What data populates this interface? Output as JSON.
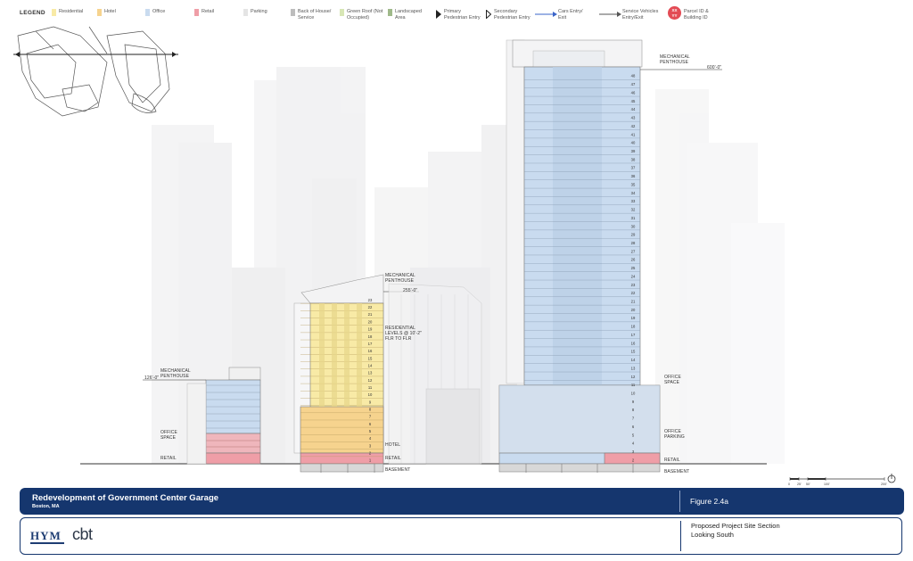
{
  "legend": {
    "title": "LEGEND",
    "items": [
      {
        "label": "Residential",
        "color": "#f8eaa6"
      },
      {
        "label": "Hotel",
        "color": "#f6d38e"
      },
      {
        "label": "Office",
        "color": "#c9dbef"
      },
      {
        "label": "Retail",
        "color": "#ef9ea7"
      },
      {
        "label": "Parking",
        "color": "#e4e4e4"
      },
      {
        "label": "Back of House/ Service",
        "color": "#bdbdbd"
      },
      {
        "label": "Green Roof (Not Occupied)",
        "color": "#d7e6b5"
      },
      {
        "label": "Landscaped Area",
        "color": "#9fb98a"
      }
    ],
    "arrows": [
      {
        "label": "Primary Pedestrian Entry",
        "icon": "filled-triangle-icon"
      },
      {
        "label": "Secondary Pedestrian Entry",
        "icon": "outline-triangle-icon"
      },
      {
        "label": "Cars Entry/ Exit",
        "icon": "blue-arrow-icon",
        "color": "#3a64c8"
      },
      {
        "label": "Service Vehicles Entry/Exit",
        "icon": "gray-arrow-icon",
        "color": "#555555"
      }
    ],
    "parcel": {
      "badge_top": "XX",
      "badge_bottom": "YY",
      "label": "Parcel ID & Building ID"
    }
  },
  "annotations": {
    "left_penthouse": "MECHANICAL PENTHOUSE",
    "left_height": "126'-0\"",
    "left_office": "OFFICE SPACE",
    "left_retail": "RETAIL",
    "mid_penthouse": "MECHANICAL PENTHOUSE",
    "mid_height": "255'-0\"",
    "mid_residential": "RESIDENTIAL LEVELS @ 10'-2\" FLR TO FLR",
    "mid_hotel": "HOTEL",
    "mid_retail": "RETAIL",
    "mid_basement": "BASEMENT",
    "tower_penthouse": "MECHANICAL PENTHOUSE",
    "tower_height": "600'-0\"",
    "tower_office_space": "OFFICE SPACE",
    "tower_office_parking": "OFFICE PARKING",
    "tower_retail": "RETAIL",
    "tower_basement": "BASEMENT"
  },
  "mid_floors": [
    "23",
    "22",
    "21",
    "20",
    "19",
    "18",
    "17",
    "16",
    "15",
    "14",
    "13",
    "12",
    "11",
    "10",
    "9",
    "8",
    "7",
    "6",
    "5",
    "4",
    "3",
    "2",
    "1"
  ],
  "tower_floors": [
    "48",
    "47",
    "46",
    "45",
    "44",
    "43",
    "42",
    "41",
    "40",
    "39",
    "38",
    "37",
    "36",
    "35",
    "34",
    "33",
    "32",
    "31",
    "30",
    "29",
    "28",
    "27",
    "26",
    "25",
    "24",
    "23",
    "22",
    "21",
    "20",
    "19",
    "18",
    "17",
    "16",
    "15",
    "14",
    "13",
    "12",
    "11",
    "10",
    "9",
    "8",
    "7",
    "6",
    "5",
    "4",
    "3",
    "2"
  ],
  "scale_labels": [
    "0",
    "25'",
    "50'",
    "100'",
    "200'"
  ],
  "footer": {
    "project": "Redevelopment of Government Center Garage",
    "location": "Boston, MA",
    "figure": "Figure 2.4a",
    "description_line1": "Proposed Project Site Section",
    "description_line2": "Looking South",
    "logo_left": "HYM",
    "logo_right": "cbt"
  }
}
